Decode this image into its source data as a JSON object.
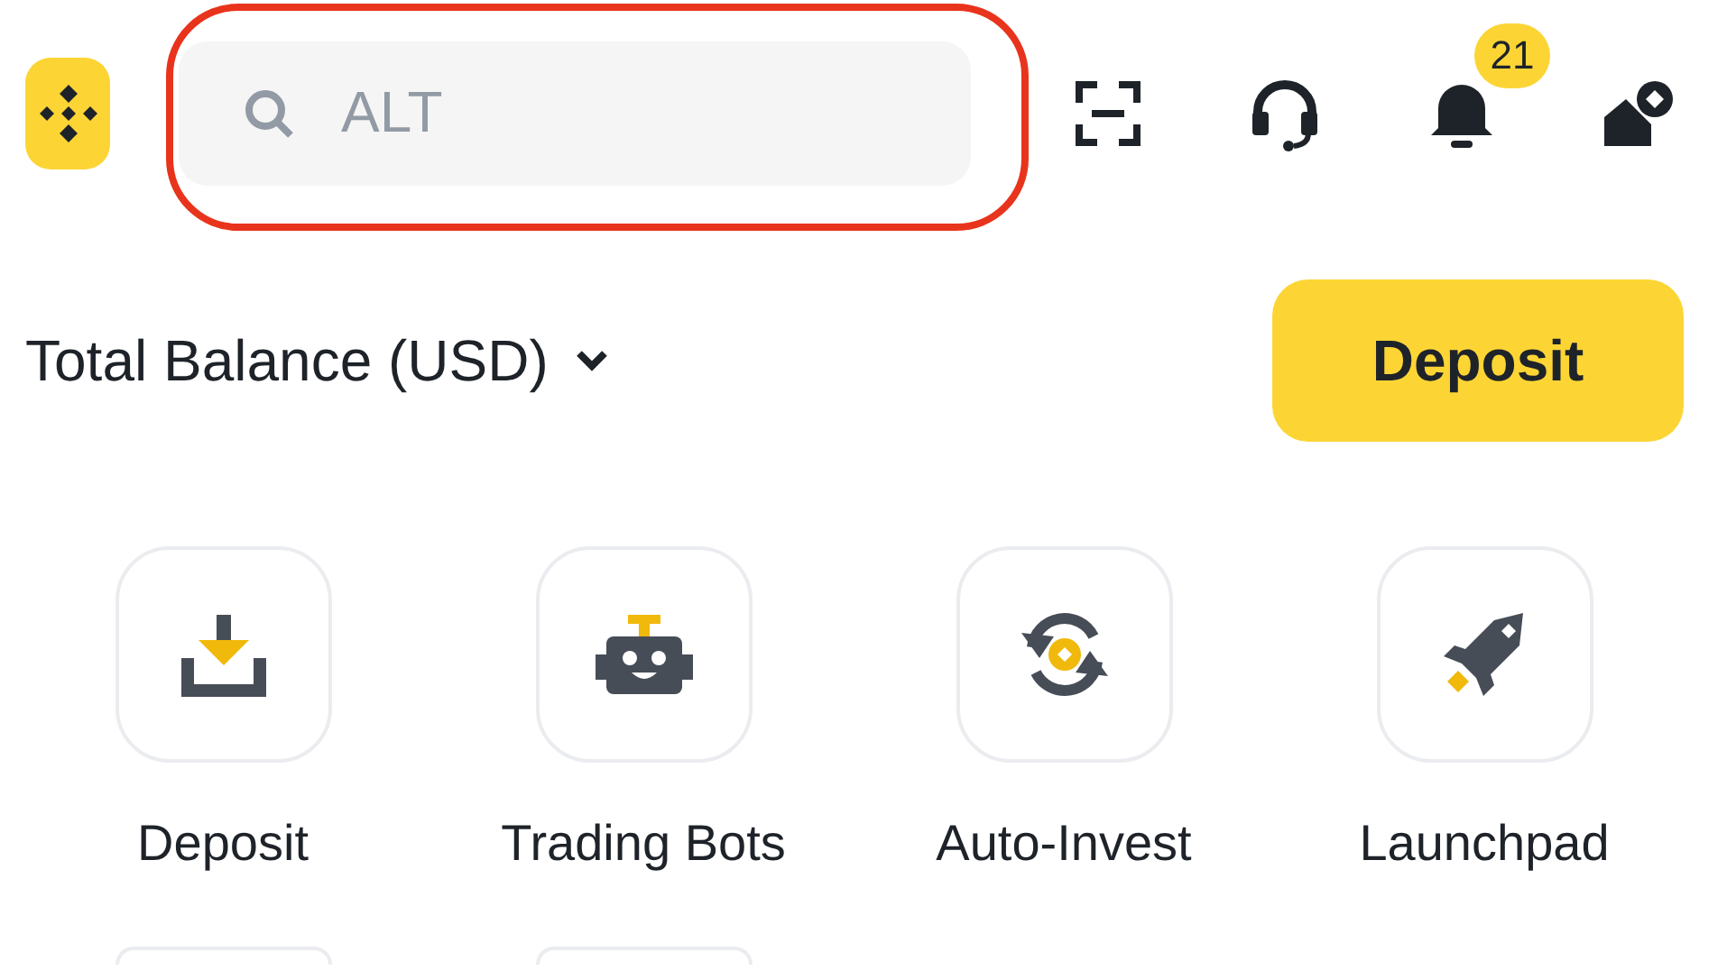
{
  "header": {
    "search": {
      "placeholder": "ALT",
      "highlighted": true
    },
    "actions": [
      {
        "kind": "scan"
      },
      {
        "kind": "support"
      },
      {
        "kind": "notifications",
        "badge": "21"
      },
      {
        "kind": "profile"
      }
    ]
  },
  "balance": {
    "label": "Total Balance (USD)",
    "button": "Deposit"
  },
  "shortcuts": [
    {
      "kind": "deposit",
      "label": "Deposit"
    },
    {
      "kind": "bot",
      "label": "Trading Bots"
    },
    {
      "kind": "invest",
      "label": "Auto-Invest"
    },
    {
      "kind": "rocket",
      "label": "Launchpad"
    }
  ]
}
